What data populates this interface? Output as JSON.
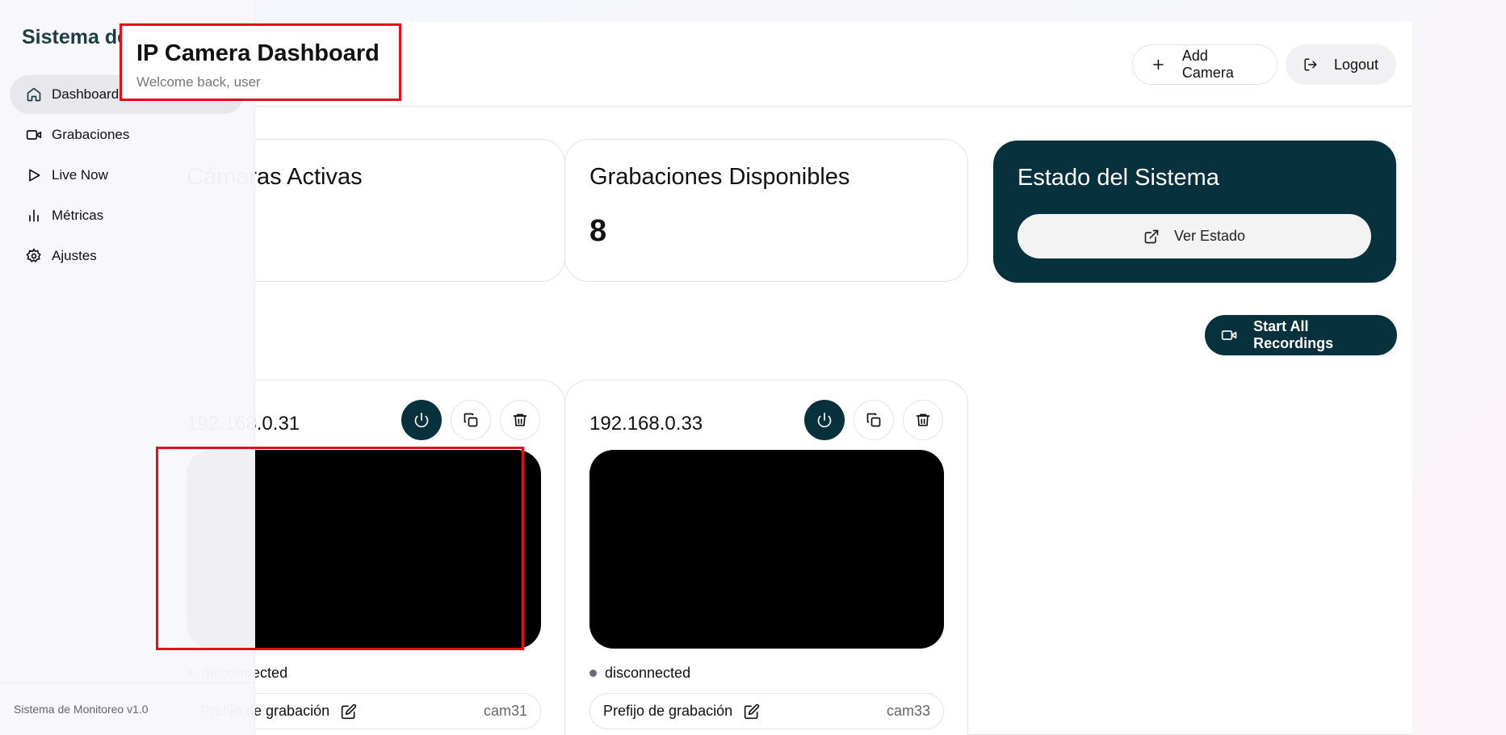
{
  "app": {
    "brand": "Sistema de Monitoreo",
    "version_footer": "Sistema de Monitoreo v1.0"
  },
  "sidebar": {
    "items": [
      {
        "label": "Dashboard",
        "icon": "home-icon",
        "active": true
      },
      {
        "label": "Grabaciones",
        "icon": "video-icon",
        "active": false
      },
      {
        "label": "Live Now",
        "icon": "play-icon",
        "active": false
      },
      {
        "label": "Métricas",
        "icon": "bar-chart-icon",
        "active": false
      },
      {
        "label": "Ajustes",
        "icon": "gear-icon",
        "active": false
      }
    ]
  },
  "header": {
    "title": "IP Camera Dashboard",
    "subtitle": "Welcome back, user",
    "add_camera_label": "Add Camera",
    "logout_label": "Logout"
  },
  "stats": {
    "cameras_active_title": "Cámaras Activas",
    "cameras_active_value": "",
    "recordings_title": "Grabaciones Disponibles",
    "recordings_value": "8",
    "system_title": "Estado del Sistema",
    "system_button": "Ver Estado"
  },
  "actions": {
    "start_all_label": "Start All Recordings"
  },
  "cameras": [
    {
      "ip": "192.168.0.31",
      "status": "disconnected",
      "prefix_label": "Prefijo de grabación",
      "prefix_value": "cam31"
    },
    {
      "ip": "192.168.0.33",
      "status": "disconnected",
      "prefix_label": "Prefijo de grabación",
      "prefix_value": "cam33"
    }
  ],
  "colors": {
    "accent_dark": "#07313c",
    "highlight_red": "#e0101a"
  }
}
